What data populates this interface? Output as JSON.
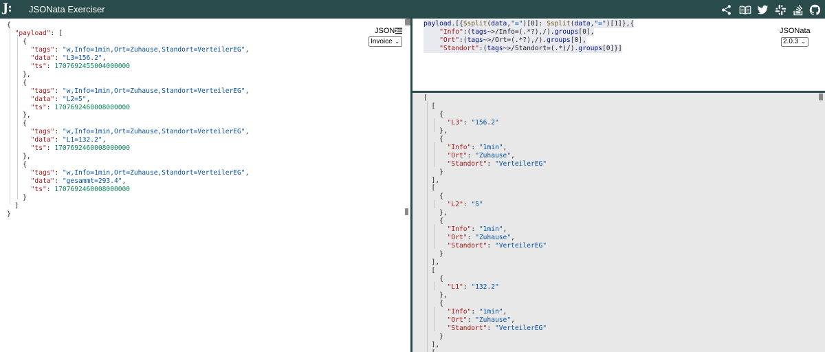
{
  "header": {
    "logo": "J:",
    "title": "JSONata Exerciser",
    "icons": [
      "share-icon",
      "book-icon",
      "twitter-icon",
      "slack-icon",
      "stackoverflow-icon",
      "github-icon"
    ]
  },
  "input": {
    "format_label": "JSON",
    "sample_selected": "Invoice",
    "lines": [
      [
        [
          "p",
          "{"
        ]
      ],
      [
        [
          "p",
          "  "
        ],
        [
          "k",
          "\"payload\""
        ],
        [
          "p",
          ": ["
        ]
      ],
      [
        [
          "p",
          "    {"
        ]
      ],
      [
        [
          "p",
          "      "
        ],
        [
          "k",
          "\"tags\""
        ],
        [
          "p",
          ": "
        ],
        [
          "s",
          "\"w,Info=1min,Ort=Zuhause,Standort=VerteilerEG\""
        ],
        [
          "p",
          ","
        ]
      ],
      [
        [
          "p",
          "      "
        ],
        [
          "k",
          "\"data\""
        ],
        [
          "p",
          ": "
        ],
        [
          "s",
          "\"L3=156.2\""
        ],
        [
          "p",
          ","
        ]
      ],
      [
        [
          "p",
          "      "
        ],
        [
          "k",
          "\"ts\""
        ],
        [
          "p",
          ": "
        ],
        [
          "n",
          "1707692455004000000"
        ]
      ],
      [
        [
          "p",
          "    },"
        ]
      ],
      [
        [
          "p",
          "    {"
        ]
      ],
      [
        [
          "p",
          "      "
        ],
        [
          "k",
          "\"tags\""
        ],
        [
          "p",
          ": "
        ],
        [
          "s",
          "\"w,Info=1min,Ort=Zuhause,Standort=VerteilerEG\""
        ],
        [
          "p",
          ","
        ]
      ],
      [
        [
          "p",
          "      "
        ],
        [
          "k",
          "\"data\""
        ],
        [
          "p",
          ": "
        ],
        [
          "s",
          "\"L2=5\""
        ],
        [
          "p",
          ","
        ]
      ],
      [
        [
          "p",
          "      "
        ],
        [
          "k",
          "\"ts\""
        ],
        [
          "p",
          ": "
        ],
        [
          "n",
          "1707692460008000000"
        ]
      ],
      [
        [
          "p",
          "    },"
        ]
      ],
      [
        [
          "p",
          "    {"
        ]
      ],
      [
        [
          "p",
          "      "
        ],
        [
          "k",
          "\"tags\""
        ],
        [
          "p",
          ": "
        ],
        [
          "s",
          "\"w,Info=1min,Ort=Zuhause,Standort=VerteilerEG\""
        ],
        [
          "p",
          ","
        ]
      ],
      [
        [
          "p",
          "      "
        ],
        [
          "k",
          "\"data\""
        ],
        [
          "p",
          ": "
        ],
        [
          "s",
          "\"L1=132.2\""
        ],
        [
          "p",
          ","
        ]
      ],
      [
        [
          "p",
          "      "
        ],
        [
          "k",
          "\"ts\""
        ],
        [
          "p",
          ": "
        ],
        [
          "n",
          "1707692460008000000"
        ]
      ],
      [
        [
          "p",
          "    },"
        ]
      ],
      [
        [
          "p",
          "    {"
        ]
      ],
      [
        [
          "p",
          "      "
        ],
        [
          "k",
          "\"tags\""
        ],
        [
          "p",
          ": "
        ],
        [
          "s",
          "\"w,Info=1min,Ort=Zuhause,Standort=VerteilerEG\""
        ],
        [
          "p",
          ","
        ]
      ],
      [
        [
          "p",
          "      "
        ],
        [
          "k",
          "\"data\""
        ],
        [
          "p",
          ": "
        ],
        [
          "s",
          "\"gesammt=293.4\""
        ],
        [
          "p",
          ","
        ]
      ],
      [
        [
          "p",
          "      "
        ],
        [
          "k",
          "\"ts\""
        ],
        [
          "p",
          ": "
        ],
        [
          "n",
          "1707692460008000000"
        ]
      ],
      [
        [
          "p",
          "    }"
        ]
      ],
      [
        [
          "p",
          "  ]"
        ]
      ],
      [
        [
          "p",
          "}"
        ]
      ]
    ]
  },
  "expression": {
    "engine_label": "JSONata",
    "version_selected": "2.0.3",
    "lines": [
      [
        [
          "v",
          "payload"
        ],
        [
          "p",
          ".[{"
        ],
        [
          "f",
          "$split"
        ],
        [
          "p",
          "("
        ],
        [
          "v",
          "data"
        ],
        [
          "p",
          ","
        ],
        [
          "s",
          "\"=\""
        ],
        [
          "p",
          ")[0]: "
        ],
        [
          "f",
          "$split"
        ],
        [
          "p",
          "("
        ],
        [
          "v",
          "data"
        ],
        [
          "p",
          ","
        ],
        [
          "s",
          "\"=\""
        ],
        [
          "p",
          ")[1]},{"
        ]
      ],
      [
        [
          "p",
          "    "
        ],
        [
          "k",
          "\"Info\""
        ],
        [
          "p",
          ":("
        ],
        [
          "v",
          "tags"
        ],
        [
          "p",
          "~>/Info=(.*?),/)."
        ],
        [
          "v",
          "groups"
        ],
        [
          "p",
          "[0],"
        ]
      ],
      [
        [
          "p",
          "    "
        ],
        [
          "k",
          "\"Ort\""
        ],
        [
          "p",
          ":("
        ],
        [
          "v",
          "tags"
        ],
        [
          "p",
          "~>/Ort=(.*?),/)."
        ],
        [
          "v",
          "groups"
        ],
        [
          "p",
          "[0],"
        ]
      ],
      [
        [
          "p",
          "    "
        ],
        [
          "k",
          "\"Standort\""
        ],
        [
          "p",
          ":("
        ],
        [
          "v",
          "tags"
        ],
        [
          "p",
          "~>/Standort=(.*)/)."
        ],
        [
          "v",
          "groups"
        ],
        [
          "p",
          "[0]}]"
        ]
      ]
    ]
  },
  "result": {
    "lines": [
      [
        [
          "p",
          "["
        ]
      ],
      [
        [
          "p",
          "  ["
        ]
      ],
      [
        [
          "p",
          "    {"
        ]
      ],
      [
        [
          "p",
          "      "
        ],
        [
          "k",
          "\"L3\""
        ],
        [
          "p",
          ": "
        ],
        [
          "s",
          "\"156.2\""
        ]
      ],
      [
        [
          "p",
          "    },"
        ]
      ],
      [
        [
          "p",
          "    {"
        ]
      ],
      [
        [
          "p",
          "      "
        ],
        [
          "k",
          "\"Info\""
        ],
        [
          "p",
          ": "
        ],
        [
          "s",
          "\"1min\""
        ],
        [
          "p",
          ","
        ]
      ],
      [
        [
          "p",
          "      "
        ],
        [
          "k",
          "\"Ort\""
        ],
        [
          "p",
          ": "
        ],
        [
          "s",
          "\"Zuhause\""
        ],
        [
          "p",
          ","
        ]
      ],
      [
        [
          "p",
          "      "
        ],
        [
          "k",
          "\"Standort\""
        ],
        [
          "p",
          ": "
        ],
        [
          "s",
          "\"VerteilerEG\""
        ]
      ],
      [
        [
          "p",
          "    }"
        ]
      ],
      [
        [
          "p",
          "  ],"
        ]
      ],
      [
        [
          "p",
          "  ["
        ]
      ],
      [
        [
          "p",
          "    {"
        ]
      ],
      [
        [
          "p",
          "      "
        ],
        [
          "k",
          "\"L2\""
        ],
        [
          "p",
          ": "
        ],
        [
          "s",
          "\"5\""
        ]
      ],
      [
        [
          "p",
          "    },"
        ]
      ],
      [
        [
          "p",
          "    {"
        ]
      ],
      [
        [
          "p",
          "      "
        ],
        [
          "k",
          "\"Info\""
        ],
        [
          "p",
          ": "
        ],
        [
          "s",
          "\"1min\""
        ],
        [
          "p",
          ","
        ]
      ],
      [
        [
          "p",
          "      "
        ],
        [
          "k",
          "\"Ort\""
        ],
        [
          "p",
          ": "
        ],
        [
          "s",
          "\"Zuhause\""
        ],
        [
          "p",
          ","
        ]
      ],
      [
        [
          "p",
          "      "
        ],
        [
          "k",
          "\"Standort\""
        ],
        [
          "p",
          ": "
        ],
        [
          "s",
          "\"VerteilerEG\""
        ]
      ],
      [
        [
          "p",
          "    }"
        ]
      ],
      [
        [
          "p",
          "  ],"
        ]
      ],
      [
        [
          "p",
          "  ["
        ]
      ],
      [
        [
          "p",
          "    {"
        ]
      ],
      [
        [
          "p",
          "      "
        ],
        [
          "k",
          "\"L1\""
        ],
        [
          "p",
          ": "
        ],
        [
          "s",
          "\"132.2\""
        ]
      ],
      [
        [
          "p",
          "    },"
        ]
      ],
      [
        [
          "p",
          "    {"
        ]
      ],
      [
        [
          "p",
          "      "
        ],
        [
          "k",
          "\"Info\""
        ],
        [
          "p",
          ": "
        ],
        [
          "s",
          "\"1min\""
        ],
        [
          "p",
          ","
        ]
      ],
      [
        [
          "p",
          "      "
        ],
        [
          "k",
          "\"Ort\""
        ],
        [
          "p",
          ": "
        ],
        [
          "s",
          "\"Zuhause\""
        ],
        [
          "p",
          ","
        ]
      ],
      [
        [
          "p",
          "      "
        ],
        [
          "k",
          "\"Standort\""
        ],
        [
          "p",
          ": "
        ],
        [
          "s",
          "\"VerteilerEG\""
        ]
      ],
      [
        [
          "p",
          "    }"
        ]
      ],
      [
        [
          "p",
          "  ],"
        ]
      ],
      [
        [
          "p",
          "  ["
        ]
      ]
    ]
  }
}
